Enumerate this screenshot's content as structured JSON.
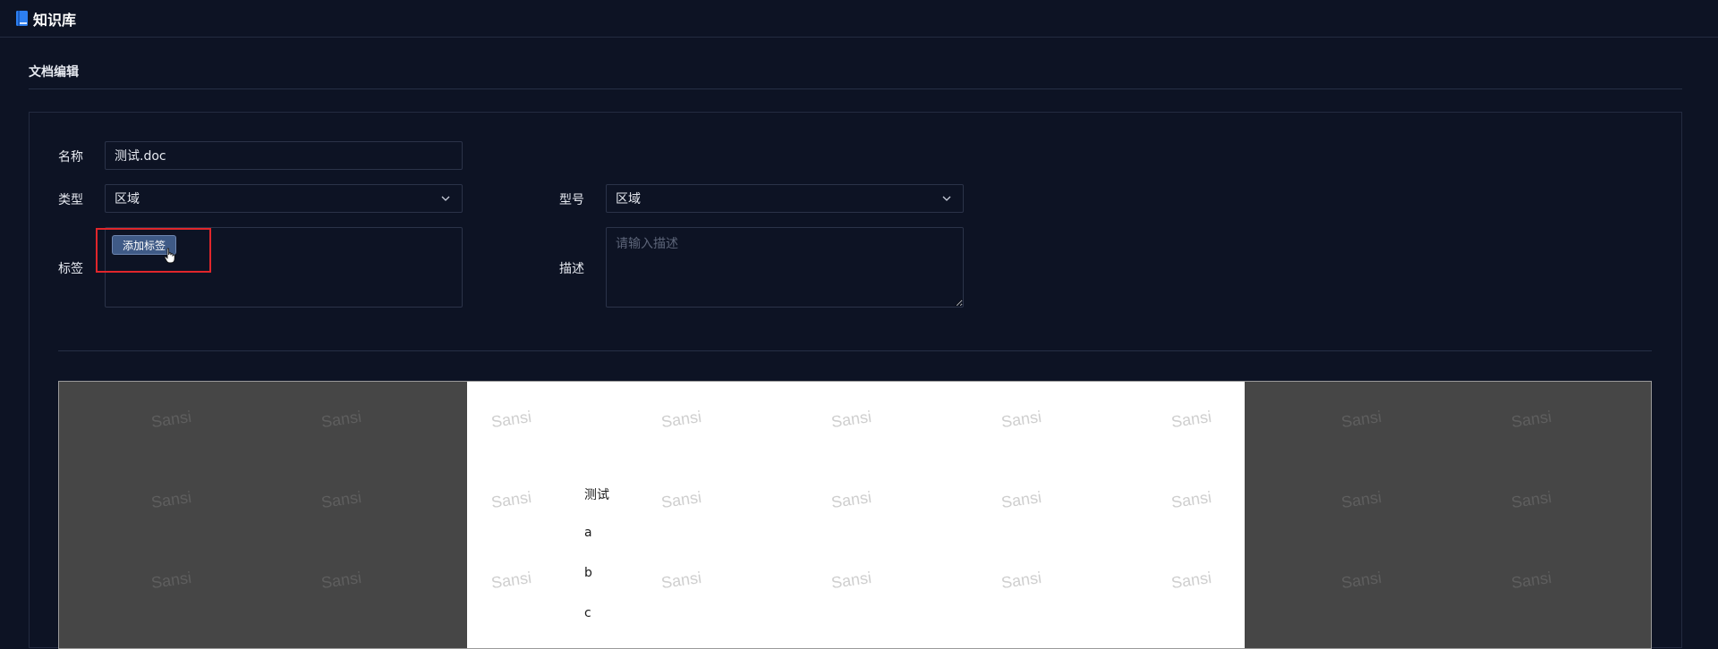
{
  "app": {
    "title": "知识库"
  },
  "section": {
    "title": "文档编辑"
  },
  "form": {
    "name_label": "名称",
    "name_value": "测试.doc",
    "type_label": "类型",
    "type_value": "区域",
    "model_label": "型号",
    "model_value": "区域",
    "tags_label": "标签",
    "add_tag_label": "添加标签",
    "desc_label": "描述",
    "desc_placeholder": "请输入描述"
  },
  "viewer": {
    "watermark": "Sansi",
    "lines": [
      "测试",
      "a",
      "b",
      "c"
    ]
  },
  "colors": {
    "background": "#0d1324",
    "accent_button": "#3f5a86",
    "highlight": "#e0262b"
  }
}
